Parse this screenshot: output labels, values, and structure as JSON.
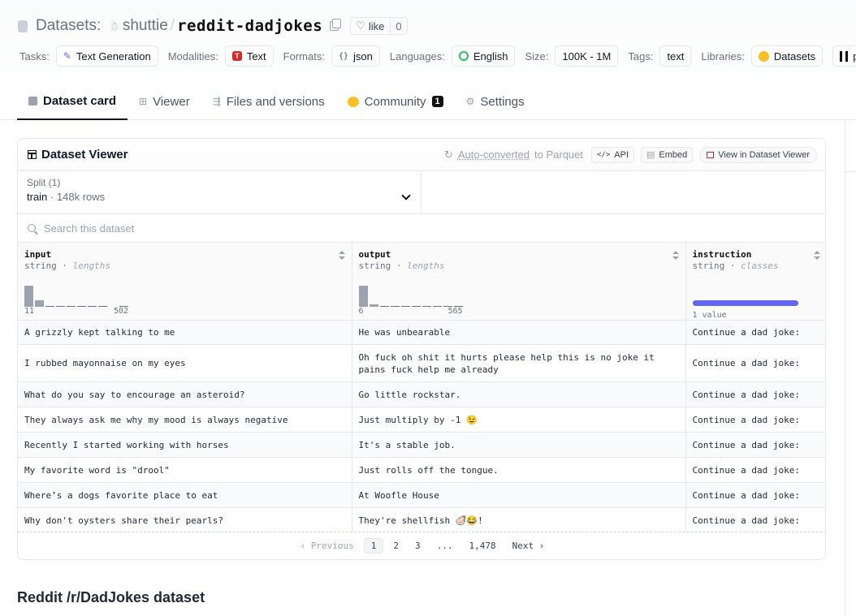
{
  "header": {
    "datasets_label": "Datasets:",
    "owner": "shuttie",
    "repo": "reddit-dadjokes",
    "like_label": "like",
    "like_count": "0"
  },
  "meta": {
    "tasks_key": "Tasks:",
    "tasks_val": "Text Generation",
    "modalities_key": "Modalities:",
    "modalities_val": "Text",
    "formats_key": "Formats:",
    "formats_val": "json",
    "languages_key": "Languages:",
    "languages_val": "English",
    "size_key": "Size:",
    "size_val": "100K - 1M",
    "tags_key": "Tags:",
    "tags_val": "text",
    "libraries_key": "Libraries:",
    "libraries_val1": "Datasets",
    "libraries_val2": "panda"
  },
  "tabs": [
    {
      "label": "Dataset card"
    },
    {
      "label": "Viewer"
    },
    {
      "label": "Files and versions"
    },
    {
      "label": "Community",
      "badge": "1"
    },
    {
      "label": "Settings"
    }
  ],
  "viewer": {
    "title": "Dataset Viewer",
    "auto_converted": "Auto-converted",
    "to_parquet": " to Parquet",
    "api_label": "API",
    "embed_label": "Embed",
    "view_label": "View in Dataset Viewer",
    "split_label": "Split (1)",
    "split_value": "train",
    "split_sep": "·",
    "split_rows": "148k rows",
    "search_placeholder": "Search this dataset"
  },
  "columns": [
    {
      "name": "input",
      "type": "string",
      "stat": "lengths",
      "min": "11",
      "max": "502"
    },
    {
      "name": "output",
      "type": "string",
      "stat": "lengths",
      "min": "6",
      "max": "565"
    },
    {
      "name": "instruction",
      "type": "string",
      "stat": "classes",
      "classes_label": "1 value"
    }
  ],
  "rows": [
    [
      "A grizzly kept talking to me",
      "He was unbearable",
      "Continue a dad joke:"
    ],
    [
      "I rubbed mayonnaise on my eyes",
      "Oh fuck oh shit it hurts please help this is no joke it pains fuck help me already",
      "Continue a dad joke:"
    ],
    [
      "What do you say to encourage an asteroid?",
      "Go little rockstar.",
      "Continue a dad joke:"
    ],
    [
      "They always ask me why my mood is always negative",
      "Just multiply by -1 😉",
      "Continue a dad joke:"
    ],
    [
      "Recently I started working with horses",
      "It's a stable job.",
      "Continue a dad joke:"
    ],
    [
      "My favorite word is \"drool\"",
      "Just rolls off the tongue.",
      "Continue a dad joke:"
    ],
    [
      "Where’s a dogs favorite place to eat",
      "At Woofle House",
      "Continue a dad joke:"
    ],
    [
      "Why don't oysters share their pearls?",
      "They're shellfish 🦪😂!",
      "Continue a dad joke:"
    ]
  ],
  "pagination": {
    "previous": "‹ Previous",
    "pages": [
      "1",
      "2",
      "3",
      "...",
      "1,478"
    ],
    "current": "1",
    "next": "Next ›"
  },
  "section_title": "Reddit /r/DadJokes dataset",
  "colors": {
    "accent": "#6366f1",
    "text_badge": "#dc2626",
    "community_icon": "#fbbf24"
  }
}
